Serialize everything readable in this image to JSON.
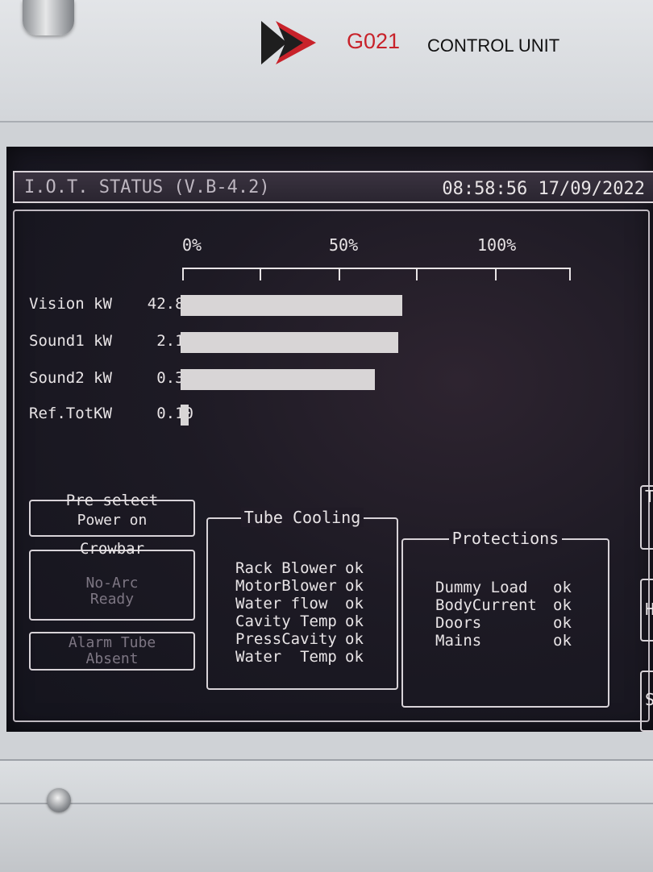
{
  "panel": {
    "unit_code": "G021",
    "unit_name": "CONTROL UNIT",
    "logo_icon": "brand-arrow-logo",
    "colors": {
      "logo_red": "#c8222a",
      "logo_dark": "#1e1e1e"
    }
  },
  "screen": {
    "title": "I.O.T. STATUS (V.B-4.2)",
    "datetime": "08:58:56 17/09/2022",
    "scale": {
      "labels": [
        "0%",
        "50%",
        "100%"
      ]
    },
    "meters": [
      {
        "label": "Vision kW",
        "value": "42.81",
        "level_pct": 57
      },
      {
        "label": "Sound1 kW",
        "value": "2.12",
        "level_pct": 56
      },
      {
        "label": "Sound2 kW",
        "value": "0.39",
        "level_pct": 50
      },
      {
        "label": "Ref.TotKW",
        "value": "0.10",
        "level_pct": 2
      }
    ],
    "preselect": {
      "title": "Pre select",
      "label": "Power on"
    },
    "crowbar": {
      "title": "Crowbar",
      "line1": "No-Arc",
      "line2": "Ready"
    },
    "alarm": {
      "line1": "Alarm Tube",
      "line2": "Absent"
    },
    "tube_cooling": {
      "title": "Tube Cooling",
      "rows": [
        {
          "label": "Rack Blower",
          "status": "ok"
        },
        {
          "label": "MotorBlower",
          "status": "ok"
        },
        {
          "label": "Water flow",
          "status": "ok"
        },
        {
          "label": "Cavity Temp",
          "status": "ok"
        },
        {
          "label": "PressCavity",
          "status": "ok"
        },
        {
          "label": "Water  Temp",
          "status": "ok"
        }
      ]
    },
    "protections": {
      "title": "Protections",
      "rows": [
        {
          "label": "Dummy Load",
          "status": "ok"
        },
        {
          "label": "BodyCurrent",
          "status": "ok"
        },
        {
          "label": "Doors",
          "status": "ok"
        },
        {
          "label": "Mains",
          "status": "ok"
        }
      ]
    },
    "side_keys": [
      "TU",
      "HI",
      "SE"
    ]
  }
}
